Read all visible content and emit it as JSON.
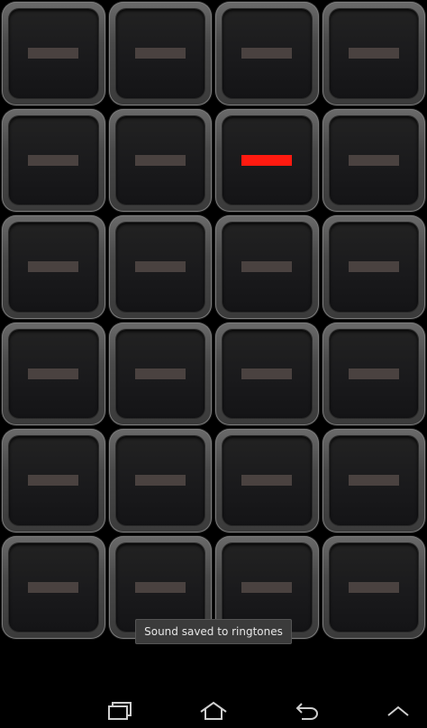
{
  "pads": {
    "rows": 6,
    "columns": 4,
    "active_row": 2,
    "active_column": 3,
    "inactive_indicator_color": "#4a4240",
    "active_indicator_color": "#ff1a10"
  },
  "toast": {
    "message": "Sound saved to ringtones"
  },
  "navbar": {
    "buttons": [
      "recent-apps-icon",
      "home-icon",
      "back-icon",
      "menu-up-icon"
    ]
  }
}
